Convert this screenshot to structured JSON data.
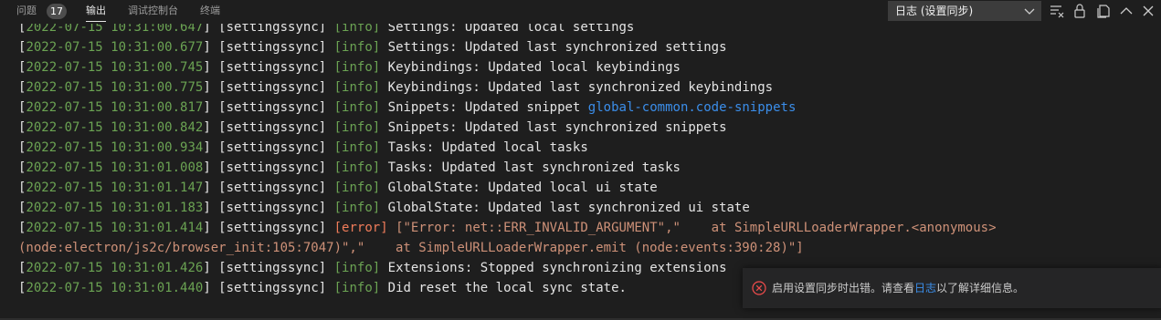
{
  "tabs": [
    {
      "label": "问题",
      "badge": "17"
    },
    {
      "label": "输出"
    },
    {
      "label": "调试控制台"
    },
    {
      "label": "终端"
    }
  ],
  "channel_select": {
    "value": "日志 (设置同步)"
  },
  "icons": {
    "clear": "clear-output-icon",
    "lock": "lock-scroll-icon",
    "open_editor": "open-in-editor-icon",
    "maximize": "chevron-up-icon",
    "close": "close-icon"
  },
  "log_lines": [
    {
      "ts": "2022-07-15 10:31:00.647",
      "src": "settingssync",
      "level": "info",
      "msg": "Settings: Updated local settings"
    },
    {
      "ts": "2022-07-15 10:31:00.677",
      "src": "settingssync",
      "level": "info",
      "msg": "Settings: Updated last synchronized settings"
    },
    {
      "ts": "2022-07-15 10:31:00.745",
      "src": "settingssync",
      "level": "info",
      "msg": "Keybindings: Updated local keybindings"
    },
    {
      "ts": "2022-07-15 10:31:00.775",
      "src": "settingssync",
      "level": "info",
      "msg": "Keybindings: Updated last synchronized keybindings"
    },
    {
      "ts": "2022-07-15 10:31:00.817",
      "src": "settingssync",
      "level": "info",
      "msg": "Snippets: Updated snippet ",
      "link": "global-common.code-snippets"
    },
    {
      "ts": "2022-07-15 10:31:00.842",
      "src": "settingssync",
      "level": "info",
      "msg": "Snippets: Updated last synchronized snippets"
    },
    {
      "ts": "2022-07-15 10:31:00.934",
      "src": "settingssync",
      "level": "info",
      "msg": "Tasks: Updated local tasks"
    },
    {
      "ts": "2022-07-15 10:31:01.008",
      "src": "settingssync",
      "level": "info",
      "msg": "Tasks: Updated last synchronized tasks"
    },
    {
      "ts": "2022-07-15 10:31:01.147",
      "src": "settingssync",
      "level": "info",
      "msg": "GlobalState: Updated local ui state"
    },
    {
      "ts": "2022-07-15 10:31:01.183",
      "src": "settingssync",
      "level": "info",
      "msg": "GlobalState: Updated last synchronized ui state"
    },
    {
      "ts": "2022-07-15 10:31:01.414",
      "src": "settingssync",
      "level": "error",
      "msg": "[\"Error: net::ERR_INVALID_ARGUMENT\",\"    at SimpleURLLoaderWrapper.<anonymous>"
    },
    {
      "continuation": "(node:electron/js2c/browser_init:105:7047)\",\"    at SimpleURLLoaderWrapper.emit (node:events:390:28)\"]"
    },
    {
      "ts": "2022-07-15 10:31:01.426",
      "src": "settingssync",
      "level": "info",
      "msg": "Extensions: Stopped synchronizing extensions"
    },
    {
      "ts": "2022-07-15 10:31:01.440",
      "src": "settingssync",
      "level": "info",
      "msg": "Did reset the local sync state."
    }
  ],
  "notification": {
    "icon": "error-circle-icon",
    "text_before": "启用设置同步时出错。请查看",
    "link": "日志",
    "text_after": "以了解详细信息。"
  }
}
